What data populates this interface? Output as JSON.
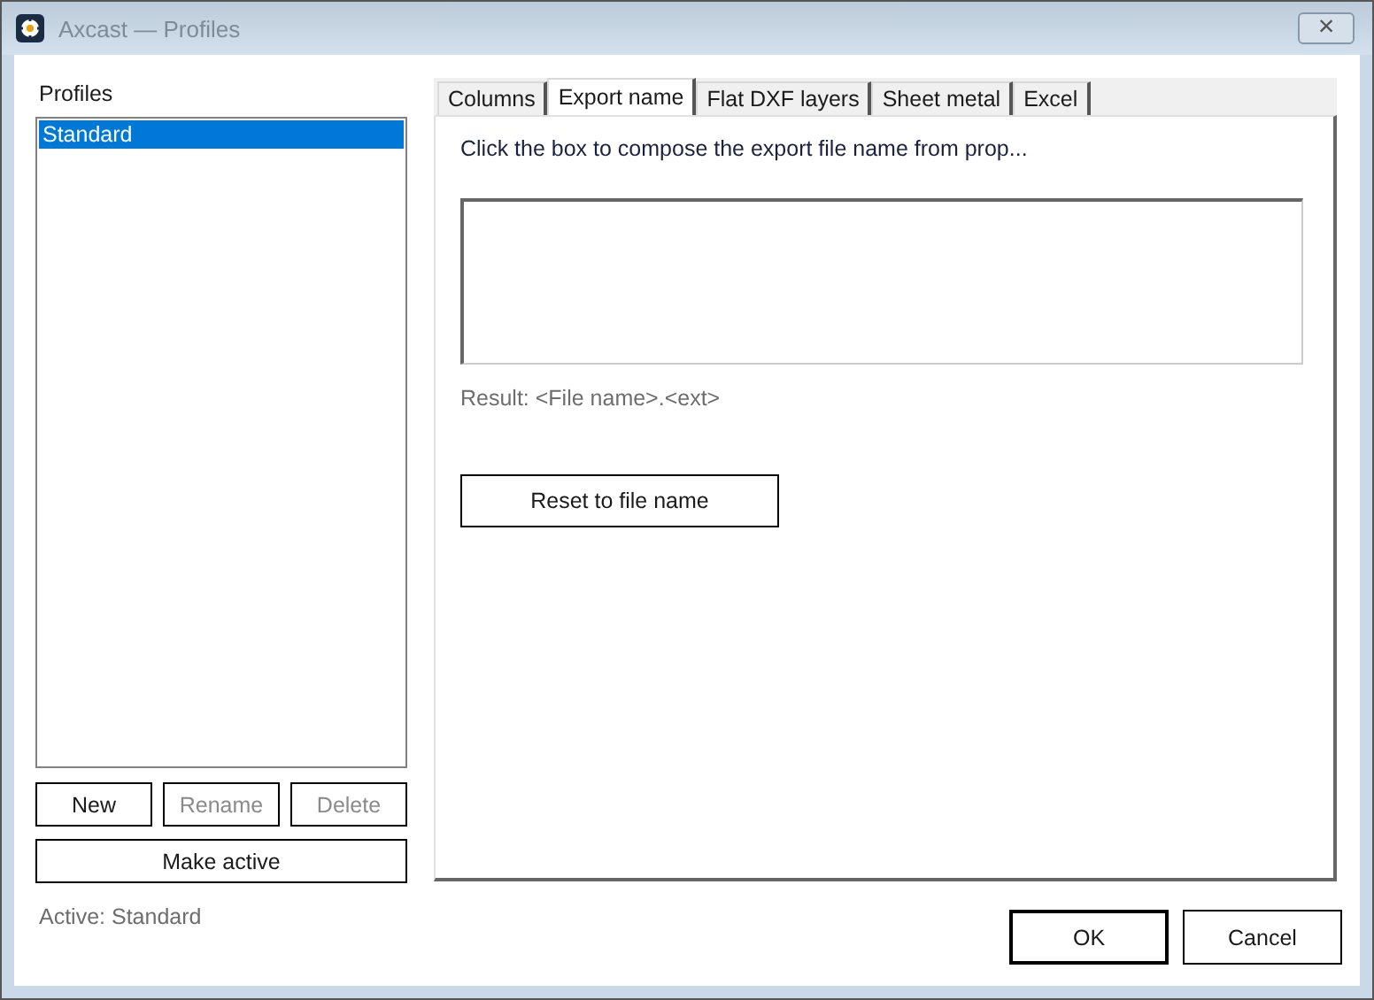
{
  "window": {
    "title": "Axcast — Profiles",
    "close": "×"
  },
  "profiles": {
    "label": "Profiles",
    "items": [
      {
        "name": "Standard",
        "selected": true
      }
    ],
    "buttons": [
      {
        "label": "New",
        "disabled": false
      },
      {
        "label": "Rename",
        "disabled": true
      },
      {
        "label": "Delete",
        "disabled": true
      }
    ],
    "make_active": "Make active",
    "active_text": "Active: Standard"
  },
  "tabs": [
    {
      "label": "Columns",
      "selected": false
    },
    {
      "label": "Export name",
      "selected": true
    },
    {
      "label": "Flat DXF layers",
      "selected": false
    },
    {
      "label": "Sheet metal",
      "selected": false
    },
    {
      "label": "Excel",
      "selected": false
    }
  ],
  "export_name": {
    "hint": "Click the box to compose the export file name from prop...",
    "result": "Result:  <File name>.<ext>",
    "reset_button": "Reset to file name"
  },
  "footer": [
    {
      "label": "OK",
      "default": true
    },
    {
      "label": "Cancel",
      "default": false
    }
  ]
}
